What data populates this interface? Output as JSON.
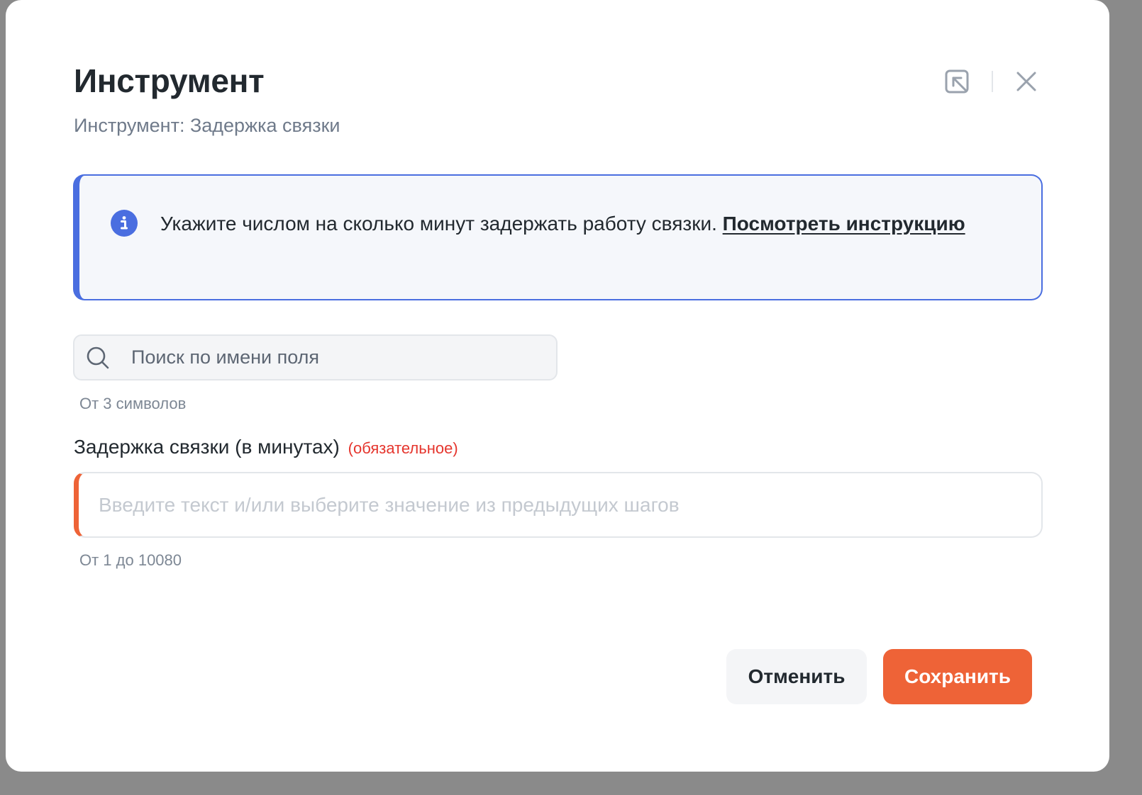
{
  "dialog": {
    "title": "Инструмент",
    "subtitle": "Инструмент: Задержка связки"
  },
  "header_actions": {
    "collapse_icon": "collapse-arrow-icon",
    "close_icon": "close-icon"
  },
  "info": {
    "icon": "info-icon",
    "text": "Укажите числом на сколько минут задержать работу связки. ",
    "link_label": "Посмотреть инструкцию"
  },
  "search": {
    "icon": "search-icon",
    "placeholder": "Поиск по имени поля",
    "value": "",
    "hint": "От 3 символов"
  },
  "delay_field": {
    "label": "Задержка связки (в минутах)",
    "required_label": "(обязательное)",
    "placeholder": "Введите текст и/или выберите значение из предыдущих шагов",
    "value": "",
    "hint": "От 1 до 10080"
  },
  "footer": {
    "cancel_label": "Отменить",
    "save_label": "Сохранить"
  },
  "colors": {
    "accent": "#ee6337",
    "info_border": "#4a6ee0",
    "required": "#e5352d"
  }
}
